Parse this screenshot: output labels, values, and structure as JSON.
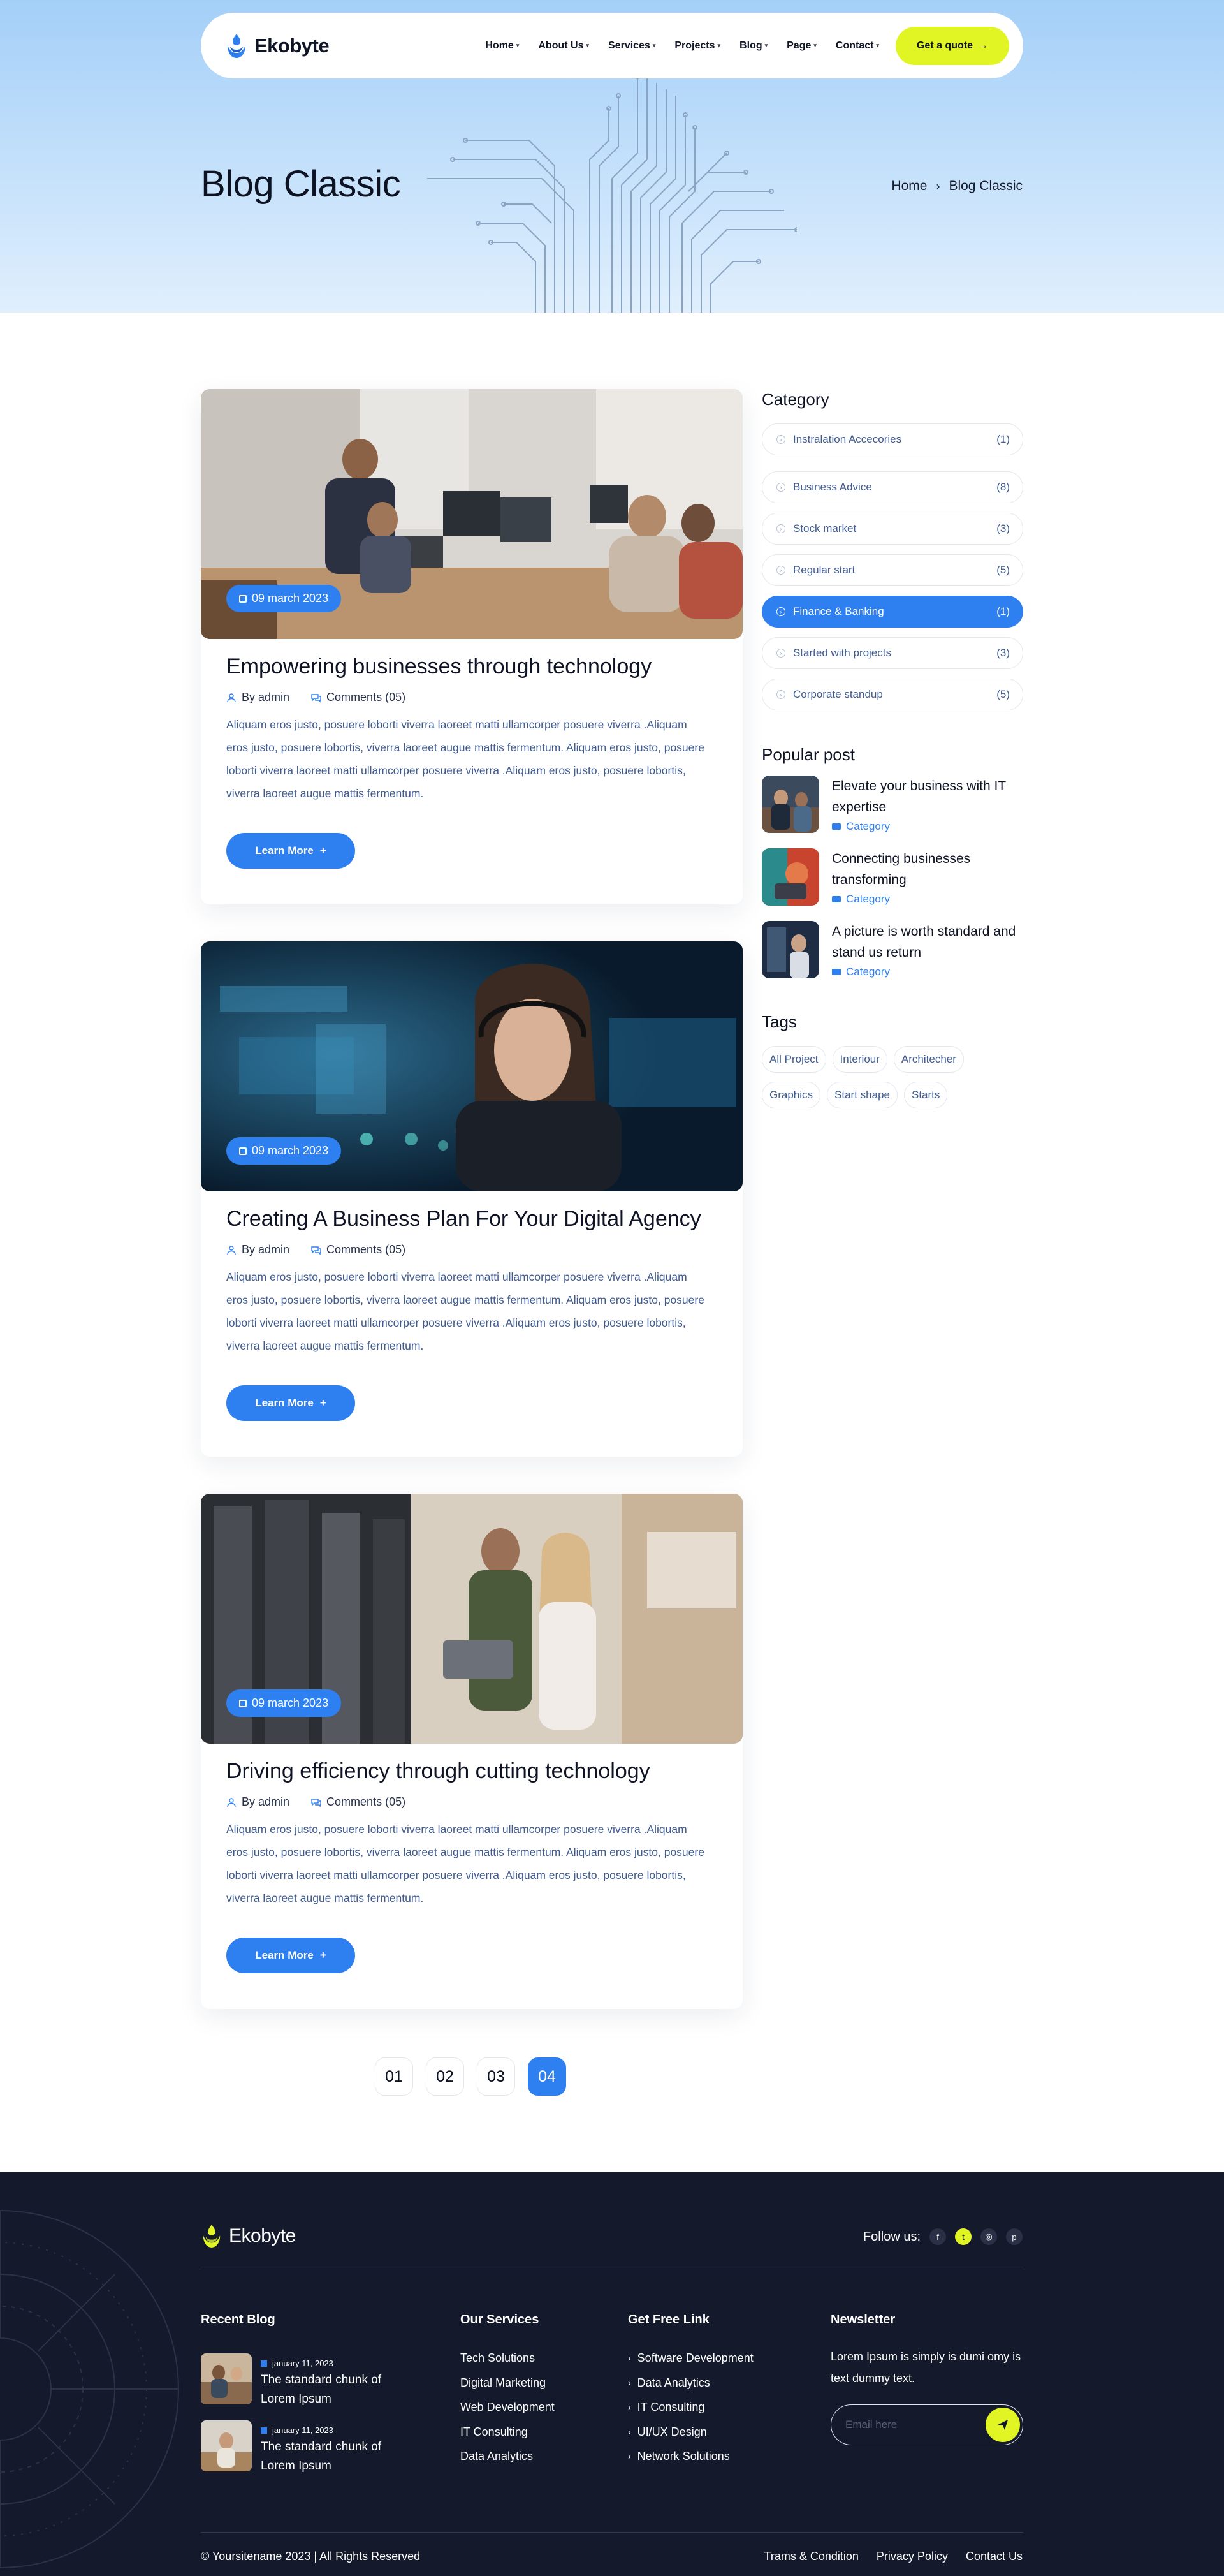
{
  "brand": {
    "name": "Ekobyte"
  },
  "nav": {
    "items": [
      {
        "label": "Home"
      },
      {
        "label": "About Us"
      },
      {
        "label": "Services"
      },
      {
        "label": "Projects"
      },
      {
        "label": "Blog"
      },
      {
        "label": "Page"
      },
      {
        "label": "Contact"
      }
    ],
    "cta_label": "Get a quote"
  },
  "hero": {
    "title": "Blog Classic",
    "breadcrumb": {
      "home": "Home",
      "current": "Blog Classic"
    }
  },
  "posts": [
    {
      "date": "09 march 2023",
      "title": "Empowering businesses through technology",
      "author": "By admin",
      "comments": "Comments (05)",
      "excerpt": "Aliquam eros justo, posuere loborti viverra laoreet matti ullamcorper posuere viverra .Aliquam eros justo, posuere lobortis, viverra laoreet augue mattis fermentum. Aliquam eros justo, posuere loborti viverra laoreet matti ullamcorper posuere viverra .Aliquam eros justo, posuere lobortis, viverra laoreet augue mattis fermentum.",
      "button": "Learn More"
    },
    {
      "date": "09 march 2023",
      "title": "Creating A Business Plan For Your Digital Agency",
      "author": "By admin",
      "comments": "Comments (05)",
      "excerpt": "Aliquam eros justo, posuere loborti viverra laoreet matti ullamcorper posuere viverra .Aliquam eros justo, posuere lobortis, viverra laoreet augue mattis fermentum. Aliquam eros justo, posuere loborti viverra laoreet matti ullamcorper posuere viverra .Aliquam eros justo, posuere lobortis, viverra laoreet augue mattis fermentum.",
      "button": "Learn More"
    },
    {
      "date": "09 march 2023",
      "title": "Driving efficiency through cutting technology",
      "author": "By admin",
      "comments": "Comments (05)",
      "excerpt": "Aliquam eros justo, posuere loborti viverra laoreet matti ullamcorper posuere viverra .Aliquam eros justo, posuere lobortis, viverra laoreet augue mattis fermentum. Aliquam eros justo, posuere loborti viverra laoreet matti ullamcorper posuere viverra .Aliquam eros justo, posuere lobortis, viverra laoreet augue mattis fermentum.",
      "button": "Learn More"
    }
  ],
  "pagination": {
    "pages": [
      "01",
      "02",
      "03",
      "04"
    ],
    "current": "04"
  },
  "sidebar": {
    "category_heading": "Category",
    "categories": [
      {
        "label": "Instralation Accecories",
        "count": "(1)"
      },
      {
        "label": "Business Advice",
        "count": "(8)"
      },
      {
        "label": "Stock market",
        "count": "(3)"
      },
      {
        "label": "Regular start",
        "count": "(5)"
      },
      {
        "label": "Finance & Banking",
        "count": "(1)",
        "active": true
      },
      {
        "label": "Started with projects",
        "count": "(3)"
      },
      {
        "label": "Corporate standup",
        "count": "(5)"
      }
    ],
    "popular_heading": "Popular post",
    "popular": [
      {
        "title": "Elevate your business with IT expertise",
        "category": "Category"
      },
      {
        "title": "Connecting businesses transforming",
        "category": "Category"
      },
      {
        "title": "A picture is worth standard and stand us return",
        "category": "Category"
      }
    ],
    "tags_heading": "Tags",
    "tags": [
      "All Project",
      "Interiour",
      "Architecher",
      "Graphics",
      "Start shape",
      "Starts"
    ]
  },
  "footer": {
    "follow_label": "Follow us:",
    "social_icons": [
      "facebook-icon",
      "twitter-icon",
      "instagram-icon",
      "pinterest-icon"
    ],
    "recent_blog": {
      "heading": "Recent Blog",
      "items": [
        {
          "date": "january 11, 2023",
          "title": "The standard chunk of Lorem Ipsum"
        },
        {
          "date": "january 11, 2023",
          "title": "The standard chunk of Lorem Ipsum"
        }
      ]
    },
    "services": {
      "heading": "Our Services",
      "items": [
        "Tech Solutions",
        "Digital Marketing",
        "Web Development",
        "IT Consulting",
        "Data Analytics"
      ]
    },
    "free_links": {
      "heading": "Get Free Link",
      "items": [
        "Software Development",
        "Data Analytics",
        "IT Consulting",
        "UI/UX Design",
        "Network Solutions"
      ]
    },
    "newsletter": {
      "heading": "Newsletter",
      "text": "Lorem Ipsum is simply is dumi omy is text  dummy text.",
      "placeholder": "Email here"
    },
    "copyright": "© Yoursitename  2023 | All Rights Reserved",
    "legal": [
      "Trams & Condition",
      "Privacy Policy",
      "Contact Us"
    ]
  },
  "colors": {
    "accent": "#2e80f0",
    "cta": "#e2f524",
    "footer_bg": "#141a2c",
    "hero_bg": "#a4cff8"
  }
}
